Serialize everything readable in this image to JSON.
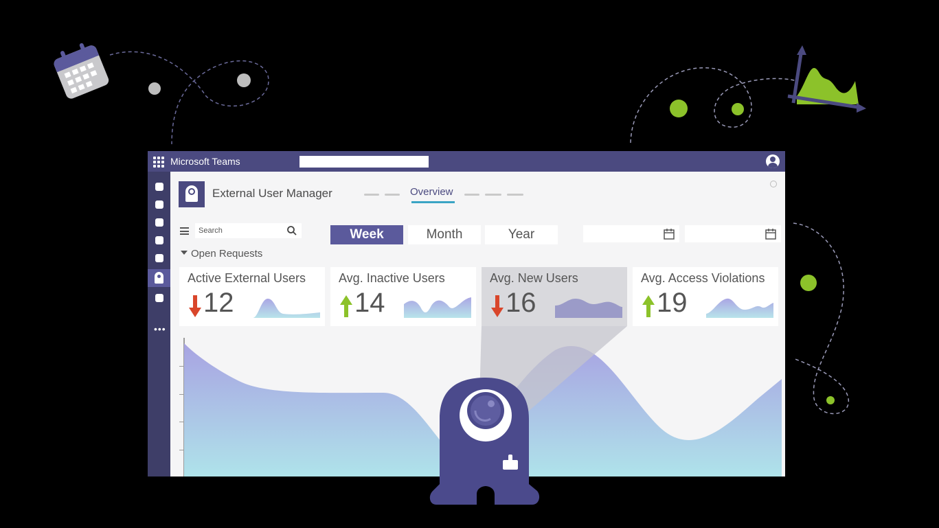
{
  "titlebar": {
    "app_title": "Microsoft Teams"
  },
  "app": {
    "name": "External User Manager",
    "tabs": [
      {
        "label": "Overview",
        "active": true
      }
    ]
  },
  "search": {
    "placeholder": "Search"
  },
  "time_range": {
    "options": [
      "Week",
      "Month",
      "Year"
    ],
    "selected": "Week"
  },
  "section": {
    "label": "Open Requests"
  },
  "kpis": [
    {
      "label": "Active External Users",
      "value": "12",
      "trend": "down",
      "trend_color": "#d9462b"
    },
    {
      "label": "Avg. Inactive Users",
      "value": "14",
      "trend": "up",
      "trend_color": "#8cc22a"
    },
    {
      "label": "Avg. New Users",
      "value": "16",
      "trend": "down",
      "trend_color": "#d9462b",
      "highlighted": true
    },
    {
      "label": "Avg. Access Violations",
      "value": "19",
      "trend": "up",
      "trend_color": "#8cc22a"
    }
  ],
  "colors": {
    "brand": "#4b4a80",
    "accent_tab": "#3aa4c4",
    "chart_top": "#aaa6e4",
    "chart_bottom": "#aee2ea",
    "decor_green": "#8cc22a"
  },
  "icons": [
    "waffle-icon",
    "profile-icon",
    "search-icon",
    "calendar-icon",
    "hamburger-menu-icon",
    "arrow-up-icon",
    "arrow-down-icon",
    "mascot-illustration"
  ]
}
